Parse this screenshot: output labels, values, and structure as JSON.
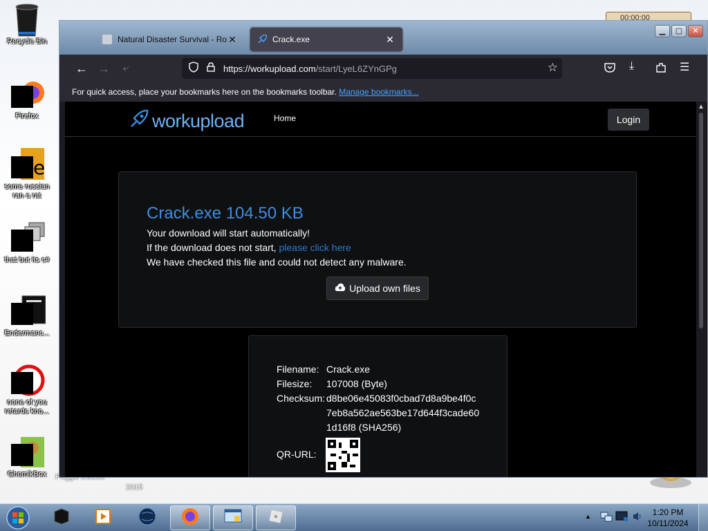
{
  "desktop": {
    "icons": [
      {
        "label": "Recycle Bin"
      },
      {
        "label": "Firefox"
      },
      {
        "label": "some russian ran a rat"
      },
      {
        "label": "that but its c#"
      },
      {
        "label": "Endermanc..."
      },
      {
        "label": "none of you retards kno..."
      },
      {
        "label": "GhomikBox"
      }
    ],
    "partial_labels": [
      "Peggle Deluxe",
      "2015"
    ],
    "widget_time": "00:00:00"
  },
  "browser": {
    "tabs": [
      {
        "title": "Natural Disaster Survival - Roblox",
        "close": "✕"
      },
      {
        "title": "Crack.exe",
        "close": "✕"
      }
    ],
    "url_host": "https://workupload.com",
    "url_path": "/start/LyeL6ZYnGPg",
    "bookmarks_text": "For quick access, place your bookmarks here on the bookmarks toolbar.",
    "bookmarks_link": "Manage bookmarks..."
  },
  "site": {
    "brand": "workupload",
    "nav_home": "Home",
    "login": "Login",
    "download_title": "Crack.exe 104.50 KB",
    "line1": "Your download will start automatically!",
    "line2_prefix": "If the download does not start,",
    "line2_link": "please click here",
    "line3": "We have checked this file and could not detect any malware.",
    "upload_button": "Upload own files",
    "file_info": {
      "filename_label": "Filename:",
      "filename": "Crack.exe",
      "filesize_label": "Filesize:",
      "filesize": "107008 (Byte)",
      "checksum_label": "Checksum:",
      "checksum_1": "d8be06e45083f0cbad7d8a9be4f0c",
      "checksum_2": "7eb8a562ae563be17d644f3cade60",
      "checksum_3": "1d16f8 (SHA256)",
      "qr_label": "QR-URL:"
    }
  },
  "taskbar": {
    "time": "1:20 PM",
    "date": "10/11/2024"
  },
  "colors": {
    "accent_blue": "#3e8ee0",
    "link_blue": "#2e7ad1",
    "page_bg": "#000000",
    "toolbar": "#2b2a33"
  }
}
